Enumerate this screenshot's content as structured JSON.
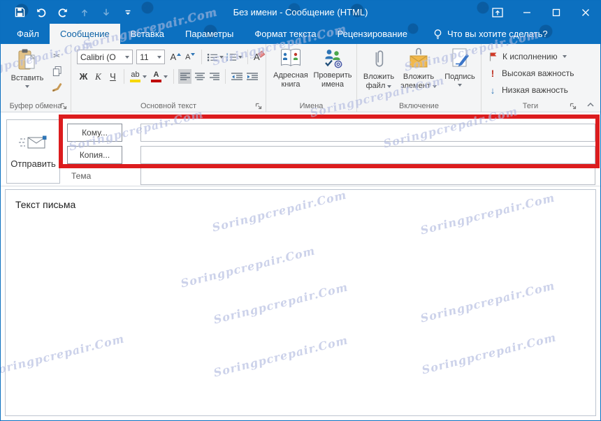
{
  "titlebar": {
    "title": "Без имени - Сообщение (HTML)"
  },
  "tabs": {
    "file": "Файл",
    "message": "Сообщение",
    "insert": "Вставка",
    "options": "Параметры",
    "format_text": "Формат текста",
    "review": "Рецензирование",
    "tell_me": "Что вы хотите сделать?"
  },
  "ribbon": {
    "clipboard": {
      "label": "Буфер обмена",
      "paste": "Вставить",
      "cut_glyph": "✂"
    },
    "basic_text": {
      "label": "Основной текст",
      "font_name": "Calibri (О",
      "font_size": "11",
      "grow": "A",
      "shrink": "A",
      "bold": "Ж",
      "italic": "К",
      "underline": "Ч",
      "highlight": "ab",
      "font_color": "А",
      "clear": "A"
    },
    "names": {
      "label": "Имена",
      "address_book": [
        "Адресная",
        "книга"
      ],
      "check_names": [
        "Проверить",
        "имена"
      ]
    },
    "include": {
      "label": "Включение",
      "attach_file": [
        "Вложить",
        "файл"
      ],
      "attach_item": [
        "Вложить",
        "элемент"
      ],
      "signature": "Подпись"
    },
    "tags": {
      "label": "Теги",
      "follow_up": "К исполнению",
      "high_importance": "Высокая важность",
      "high_glyph": "!",
      "low_importance": "Низкая важность",
      "low_glyph": "↓"
    }
  },
  "compose": {
    "send": "Отправить",
    "to_button": "Кому...",
    "cc_button": "Копия...",
    "subject_label": "Тема",
    "to_value": "",
    "cc_value": "",
    "subject_value": "",
    "body_text": "Текст письма"
  },
  "watermark": {
    "text": "Soringpcrepair.Com"
  },
  "colors": {
    "titlebar_blue": "#0c70c0",
    "annotation_red": "#dc1c1e",
    "active_tab_text": "#0d62a6"
  }
}
